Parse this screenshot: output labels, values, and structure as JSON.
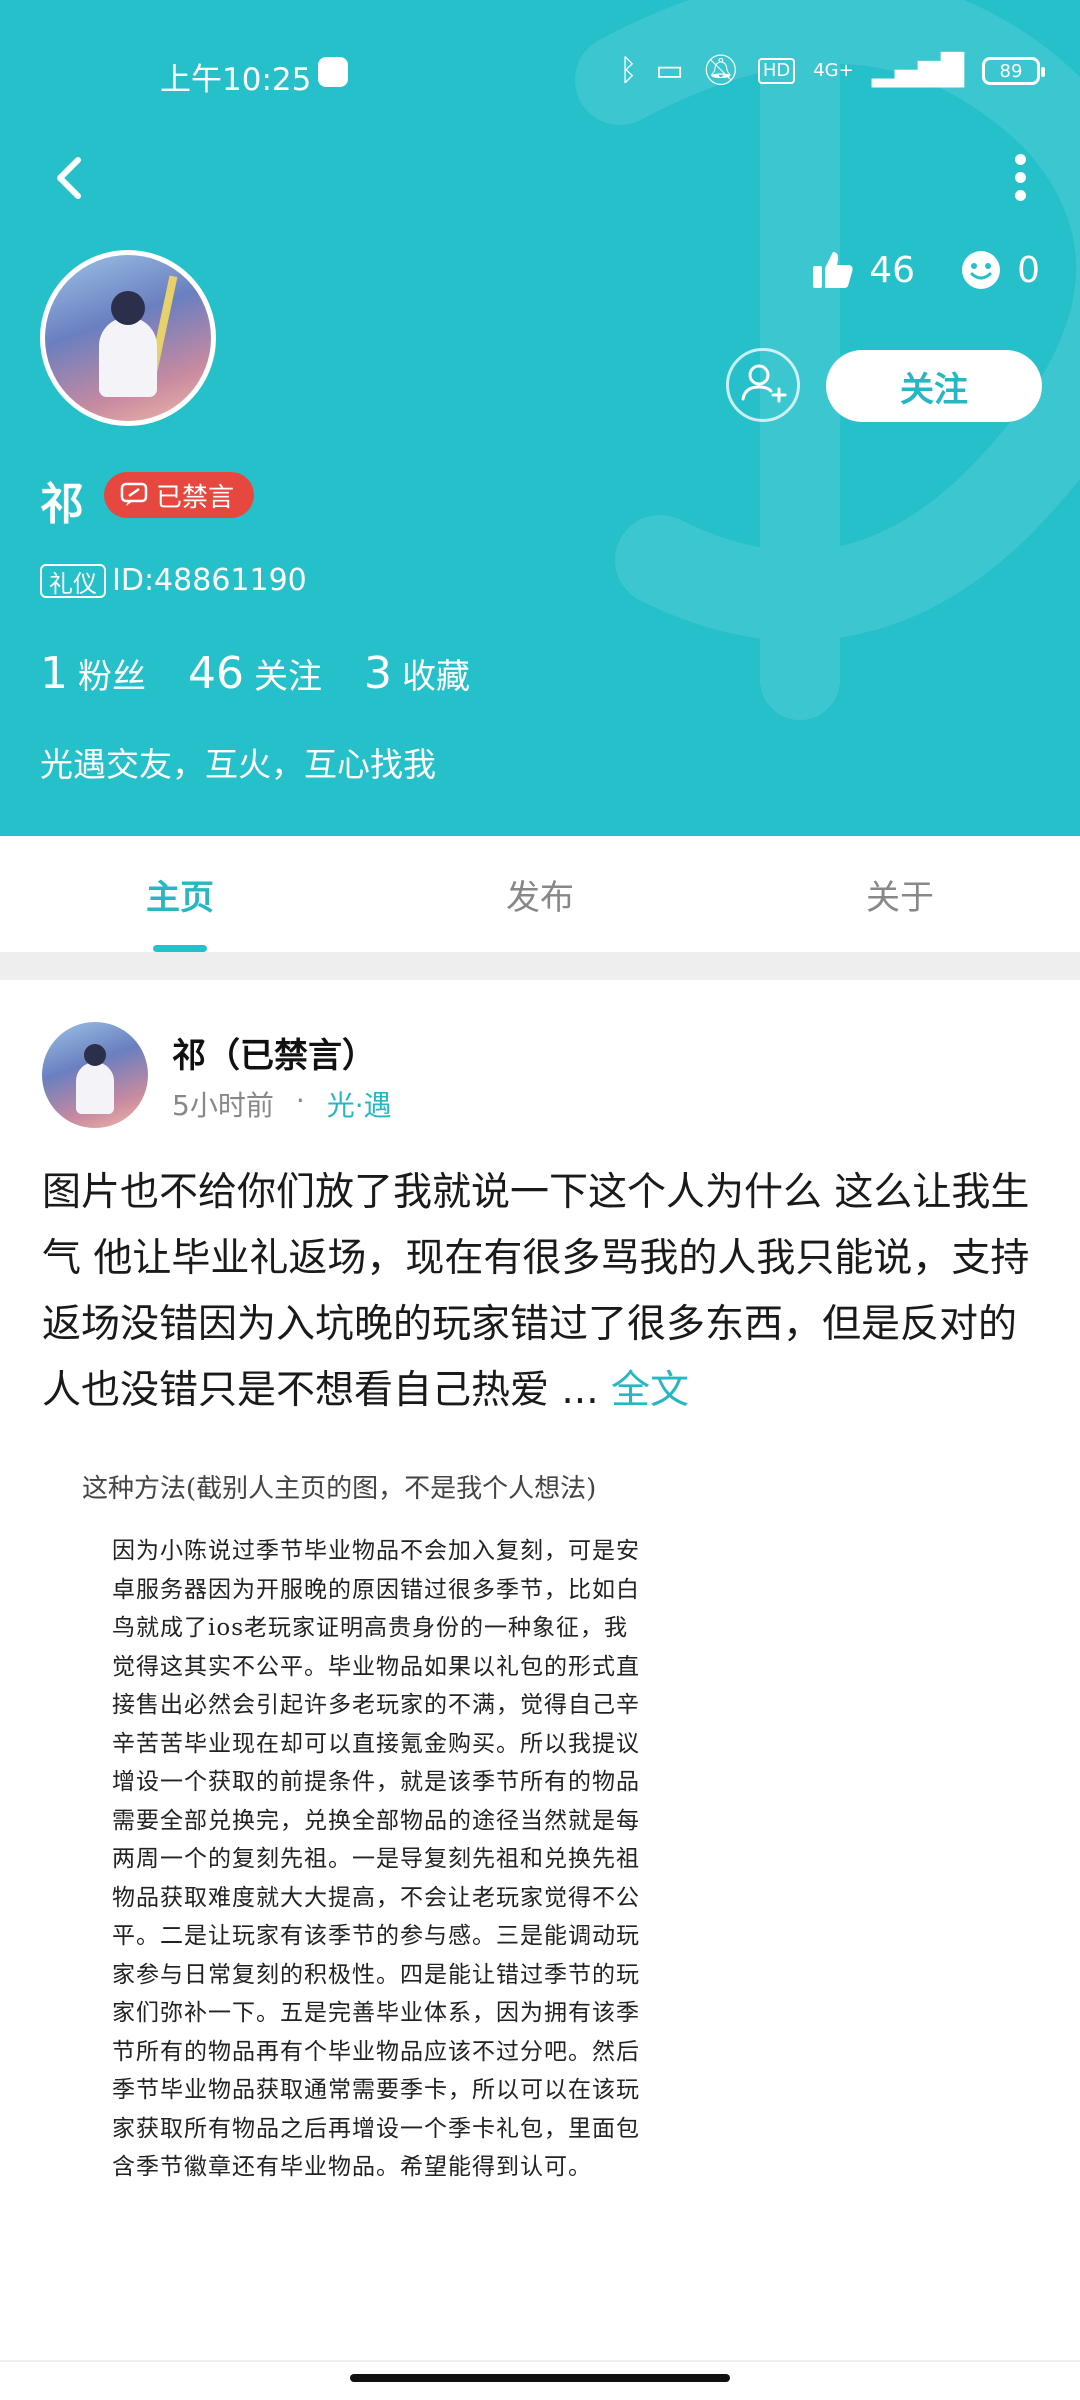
{
  "colors": {
    "accent": "#26c0cb",
    "accent_text": "#26b7c3",
    "badge_red": "#e6483f"
  },
  "status_bar": {
    "time": "上午10:25",
    "network": "4G+",
    "hd": "HD",
    "battery": "89"
  },
  "profile": {
    "likes": "46",
    "smiles": "0",
    "follow_label": "关注",
    "name": "祁",
    "muted_badge": "已禁言",
    "role_tag": "礼仪",
    "id_text": "ID:48861190",
    "counts": [
      {
        "num": "1",
        "label": "粉丝"
      },
      {
        "num": "46",
        "label": "关注"
      },
      {
        "num": "3",
        "label": "收藏"
      }
    ],
    "bio": "光遇交友，互火，互心找我"
  },
  "tabs": [
    {
      "label": "主页",
      "active": true
    },
    {
      "label": "发布",
      "active": false
    },
    {
      "label": "关于",
      "active": false
    }
  ],
  "post": {
    "author": "祁（已禁言）",
    "time": "5小时前",
    "dot": "·",
    "circle": "光·遇",
    "body": "图片也不给你们放了我就说一下这个人为什么 这么让我生气 他让毕业礼返场，现在有很多骂我的人我只能说，支持返场没错因为入坑晚的玩家错过了很多东西，但是反对的人也没错只是不想看自己热爱 ... ",
    "full_text": "全文",
    "image_caption": "这种方法(截别人主页的图，不是我个人想法)",
    "image_text": "因为小陈说过季节毕业物品不会加入复刻，可是安卓服务器因为开服晚的原因错过很多季节，比如白鸟就成了ios老玩家证明高贵身份的一种象征，我觉得这其实不公平。毕业物品如果以礼包的形式直接售出必然会引起许多老玩家的不满，觉得自己辛辛苦苦毕业现在却可以直接氪金购买。所以我提议增设一个获取的前提条件，就是该季节所有的物品需要全部兑换完，兑换全部物品的途径当然就是每两周一个的复刻先祖。一是导复刻先祖和兑换先祖物品获取难度就大大提高，不会让老玩家觉得不公平。二是让玩家有该季节的参与感。三是能调动玩家参与日常复刻的积极性。四是能让错过季节的玩家们弥补一下。五是完善毕业体系，因为拥有该季节所有的物品再有个毕业物品应该不过分吧。然后季节毕业物品获取通常需要季卡，所以可以在该玩家获取所有物品之后再增设一个季卡礼包，里面包含季节徽章还有毕业物品。希望能得到认可。"
  }
}
